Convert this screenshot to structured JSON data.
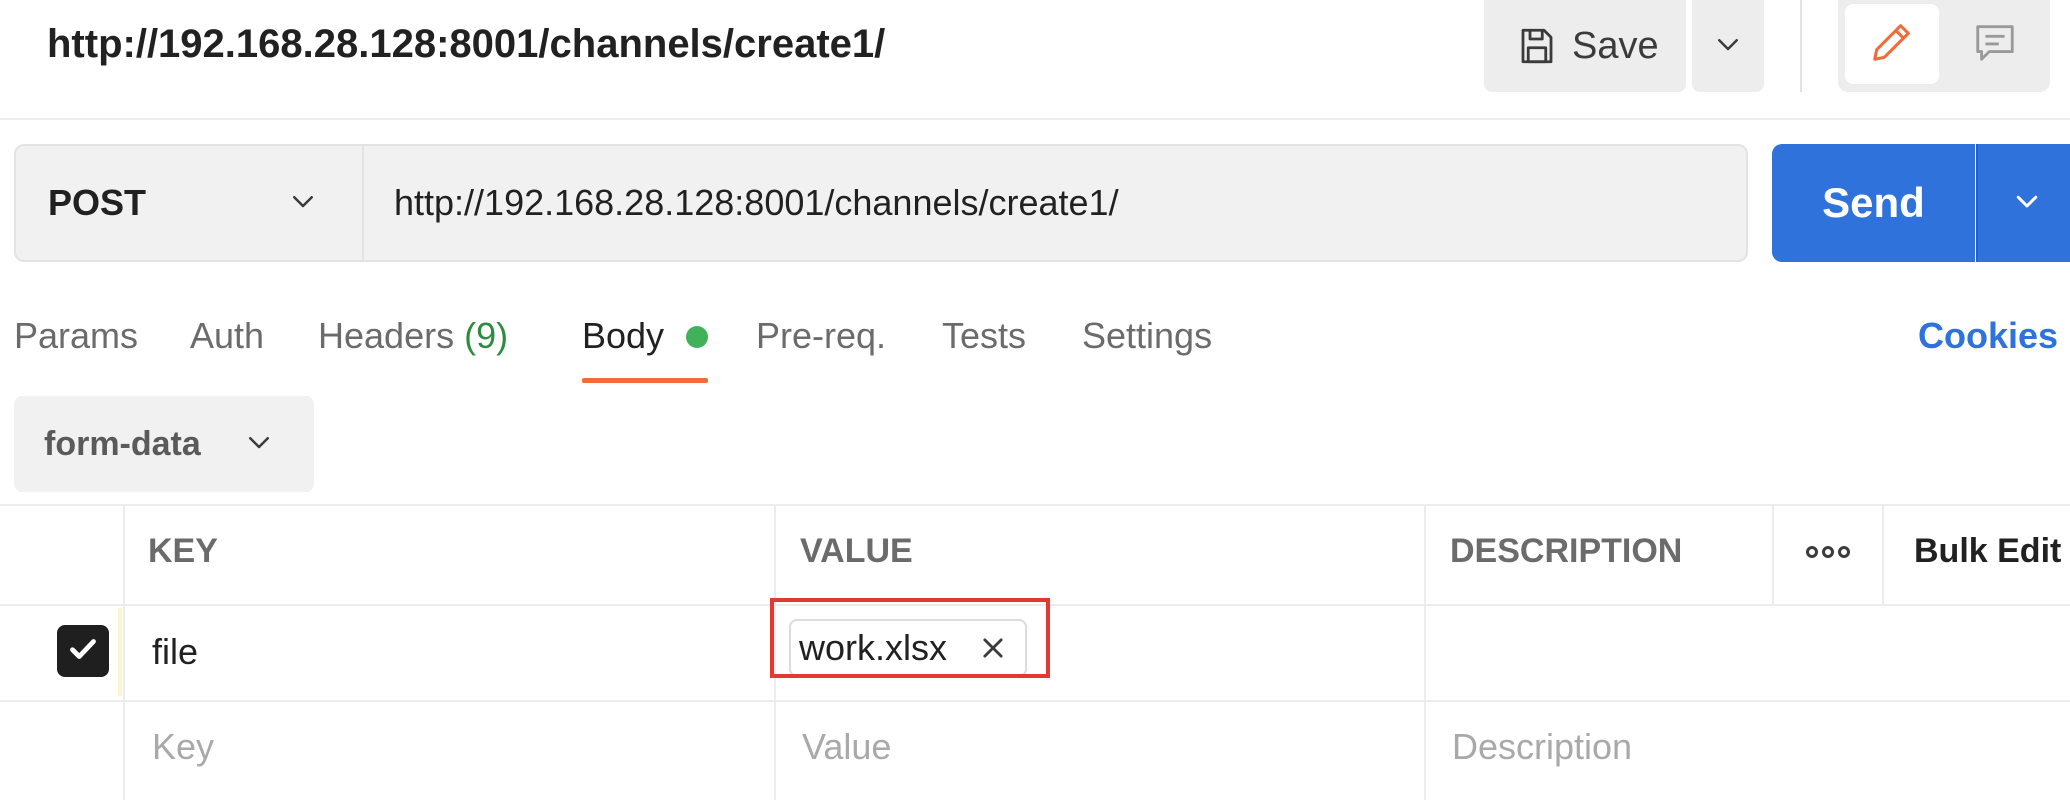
{
  "title_bar": {
    "request_name": "http://192.168.28.128:8001/channels/create1/",
    "save_label": "Save",
    "icons": [
      "save-icon",
      "chevron-down-icon",
      "pencil-icon",
      "comment-icon"
    ]
  },
  "request": {
    "method": "POST",
    "url": "http://192.168.28.128:8001/channels/create1/",
    "send_label": "Send"
  },
  "tabs": [
    {
      "label": "Params"
    },
    {
      "label": "Auth"
    },
    {
      "label": "Headers",
      "count": "(9)"
    },
    {
      "label": "Body",
      "active": true
    },
    {
      "label": "Pre-req."
    },
    {
      "label": "Tests"
    },
    {
      "label": "Settings"
    }
  ],
  "cookies_label": "Cookies",
  "body_mode": "form-data",
  "table": {
    "headers": {
      "key": "KEY",
      "value": "VALUE",
      "description": "DESCRIPTION",
      "bulk_edit": "Bulk Edit"
    },
    "rows": [
      {
        "checked": true,
        "key": "file",
        "value_file": "work.xlsx",
        "description": ""
      }
    ],
    "placeholders": {
      "key": "Key",
      "value": "Value",
      "description": "Description"
    }
  },
  "colors": {
    "accent": "#2f72db",
    "active_tab_underline": "#f26b3a",
    "body_dot": "#3fb25a",
    "headers_count": "#2e8b3f",
    "highlight": "#e23a32"
  }
}
